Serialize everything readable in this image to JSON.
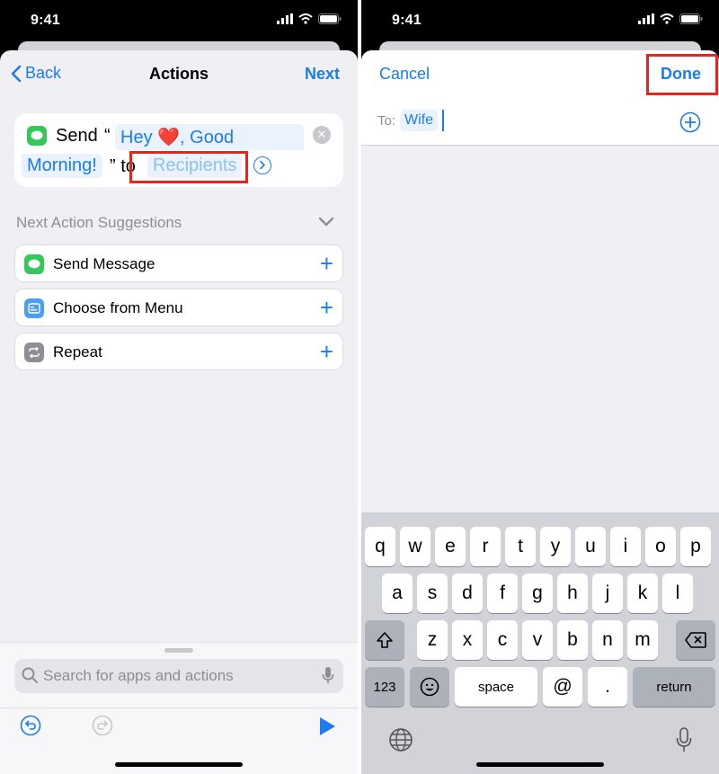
{
  "status": {
    "time": "9:41"
  },
  "left": {
    "nav": {
      "back": "Back",
      "title": "Actions",
      "next": "Next"
    },
    "action": {
      "send": "Send",
      "open_quote": "“",
      "msg_line1": "Hey ❤️, Good",
      "msg_line2": "Morning!",
      "close_quote_to": "” to",
      "recipients": "Recipients"
    },
    "suggestions": {
      "header": "Next Action Suggestions",
      "items": [
        {
          "label": "Send Message",
          "icon": "message-icon",
          "color": "#34c759"
        },
        {
          "label": "Choose from Menu",
          "icon": "menu-icon",
          "color": "#4a9ff5"
        },
        {
          "label": "Repeat",
          "icon": "repeat-icon",
          "color": "#8e8e93"
        }
      ]
    },
    "search": {
      "placeholder": "Search for apps and actions"
    }
  },
  "right": {
    "nav": {
      "cancel": "Cancel",
      "done": "Done"
    },
    "to": {
      "label": "To:",
      "chip": "Wife"
    },
    "keyboard": {
      "row1": [
        "q",
        "w",
        "e",
        "r",
        "t",
        "y",
        "u",
        "i",
        "o",
        "p"
      ],
      "row2": [
        "a",
        "s",
        "d",
        "f",
        "g",
        "h",
        "j",
        "k",
        "l"
      ],
      "row3": [
        "z",
        "x",
        "c",
        "v",
        "b",
        "n",
        "m"
      ],
      "num": "123",
      "space": "space",
      "at": "@",
      "dot": ".",
      "return": "return"
    }
  },
  "colors": {
    "accent": "#1a7cf0",
    "highlight": "#e8241d"
  }
}
